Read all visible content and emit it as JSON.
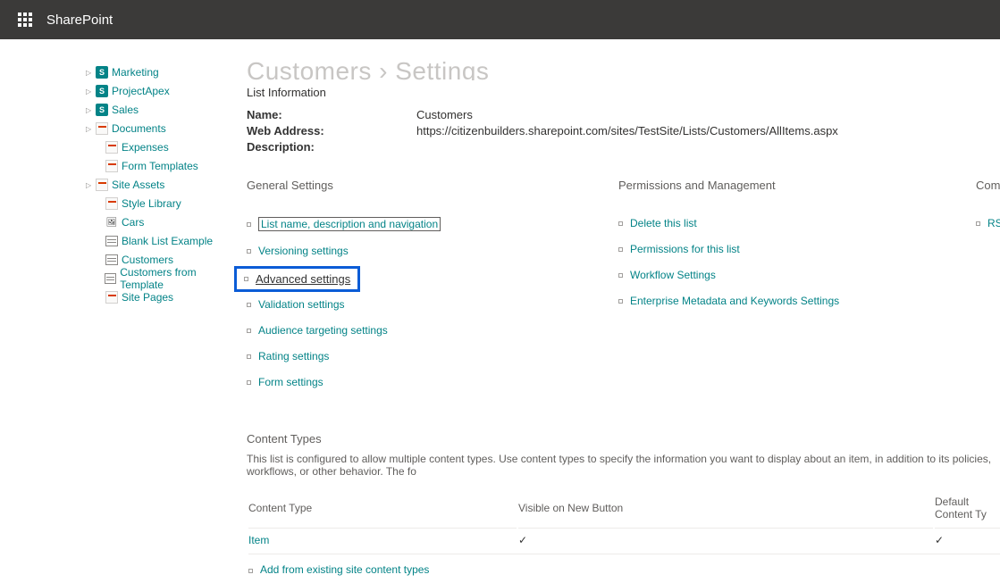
{
  "brand": "SharePoint",
  "page_title": "Customers › Settings",
  "list_info_label": "List Information",
  "info": {
    "name_k": "Name:",
    "name_v": "Customers",
    "web_k": "Web Address:",
    "web_v": "https://citizenbuilders.sharepoint.com/sites/TestSite/Lists/Customers/AllItems.aspx",
    "desc_k": "Description:",
    "desc_v": ""
  },
  "tree": [
    {
      "label": "Marketing",
      "type": "s",
      "exp": true
    },
    {
      "label": "ProjectApex",
      "type": "s",
      "exp": true
    },
    {
      "label": "Sales",
      "type": "s",
      "exp": true
    },
    {
      "label": "Documents",
      "type": "d",
      "exp": true,
      "child": false
    },
    {
      "label": "Expenses",
      "type": "d",
      "child": true
    },
    {
      "label": "Form Templates",
      "type": "d",
      "child": true
    },
    {
      "label": "Site Assets",
      "type": "d",
      "exp": true,
      "child": false
    },
    {
      "label": "Style Library",
      "type": "d",
      "child": true
    },
    {
      "label": "Cars",
      "type": "car",
      "child": true
    },
    {
      "label": "Blank List Example",
      "type": "list",
      "child": true
    },
    {
      "label": "Customers",
      "type": "list",
      "child": true
    },
    {
      "label": "Customers from Template",
      "type": "list",
      "child": true
    },
    {
      "label": "Site Pages",
      "type": "d",
      "child": true
    }
  ],
  "cols": {
    "general": "General Settings",
    "perms": "Permissions and Management",
    "comm": "Comm"
  },
  "general_links": [
    "List name, description and navigation",
    "Versioning settings",
    "Advanced settings",
    "Validation settings",
    "Audience targeting settings",
    "Rating settings",
    "Form settings"
  ],
  "perm_links": [
    "Delete this list",
    "Permissions for this list",
    "Workflow Settings",
    "Enterprise Metadata and Keywords Settings"
  ],
  "comm_links": [
    "RSS"
  ],
  "ct": {
    "head": "Content Types",
    "desc": "This list is configured to allow multiple content types. Use content types to specify the information you want to display about an item, in addition to its policies, workflows, or other behavior. The fo",
    "th1": "Content Type",
    "th2": "Visible on New Button",
    "th3": "Default Content Ty",
    "row": {
      "name": "Item",
      "visible": "✓",
      "default": "✓"
    },
    "add": "Add from existing site content types"
  }
}
